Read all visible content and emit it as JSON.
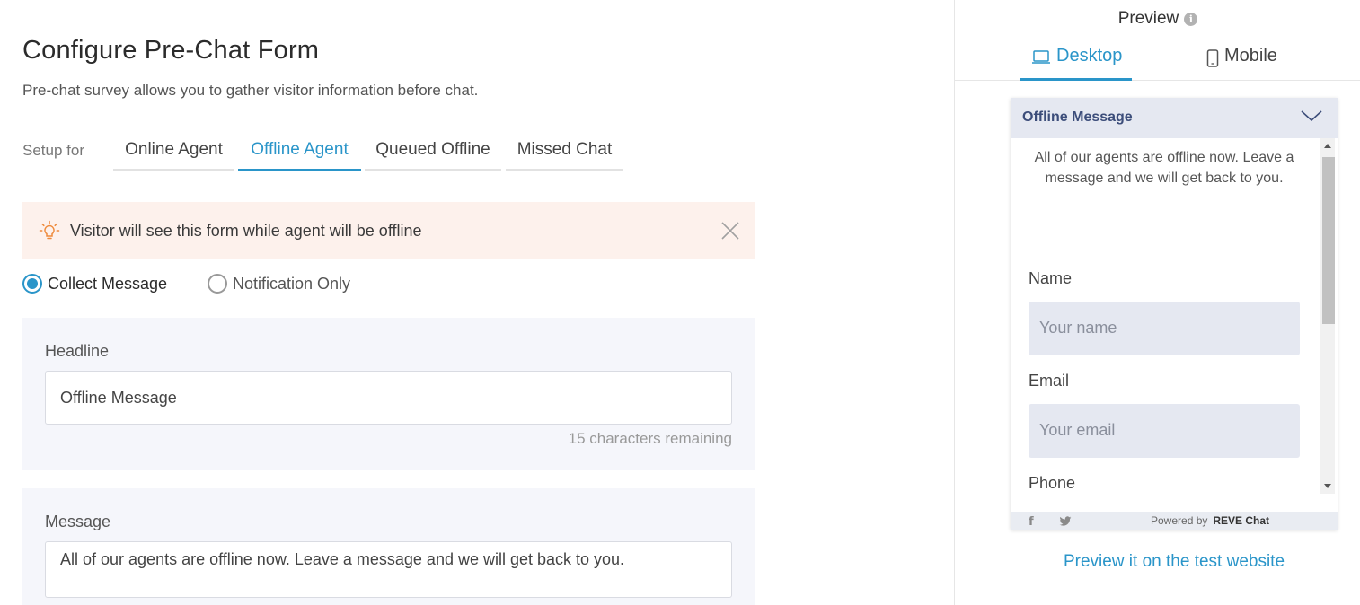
{
  "header": {
    "title": "Configure Pre-Chat Form",
    "subtitle": "Pre-chat survey allows you to gather visitor information before chat."
  },
  "setup": {
    "label": "Setup for",
    "tabs": [
      {
        "label": "Online Agent",
        "active": false
      },
      {
        "label": "Offline Agent",
        "active": true
      },
      {
        "label": "Queued Offline",
        "active": false
      },
      {
        "label": "Missed Chat",
        "active": false
      }
    ]
  },
  "notice": {
    "text": "Visitor will see this form while agent will be offline",
    "icon": "lightbulb-icon"
  },
  "mode": {
    "options": [
      {
        "label": "Collect Message",
        "checked": true
      },
      {
        "label": "Notification Only",
        "checked": false
      }
    ]
  },
  "headline": {
    "label": "Headline",
    "value": "Offline Message",
    "remaining": "15 characters remaining"
  },
  "message": {
    "label": "Message",
    "value": "All of our agents are offline now. Leave a message and we will get back to you."
  },
  "preview": {
    "title": "Preview",
    "tabs": [
      {
        "label": "Desktop",
        "active": true,
        "icon": "laptop-icon"
      },
      {
        "label": "Mobile",
        "active": false,
        "icon": "mobile-icon"
      }
    ],
    "widget": {
      "header": "Offline Message",
      "message": "All of our agents are offline now. Leave a message and we will get back to you.",
      "fields": [
        {
          "label": "Name",
          "placeholder": "Your name"
        },
        {
          "label": "Email",
          "placeholder": "Your email"
        },
        {
          "label": "Phone"
        }
      ],
      "footer": {
        "powered_by": "Powered by",
        "brand": "REVE Chat"
      }
    },
    "link": "Preview it on the test website"
  },
  "colors": {
    "accent": "#2a95c9",
    "notice_bg": "#fdf1ec",
    "card_bg": "#f5f6fb",
    "widget_header_bg": "#e5e8f1"
  }
}
